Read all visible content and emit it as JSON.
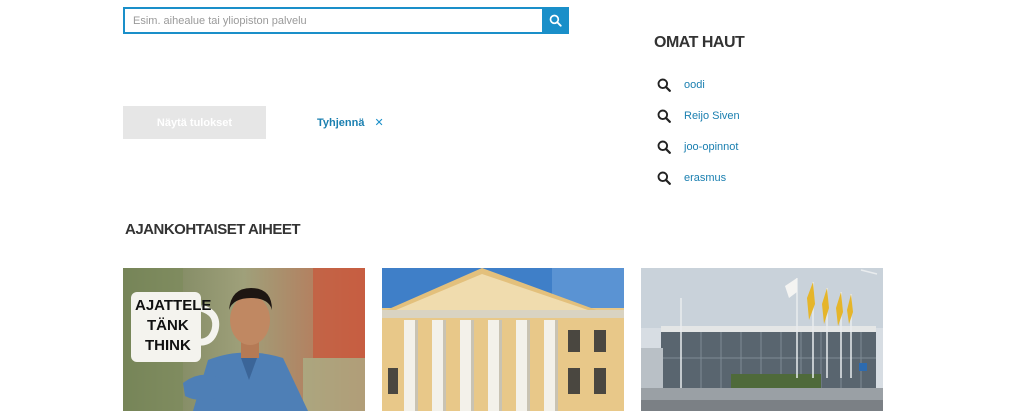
{
  "search": {
    "placeholder": "Esim. aihealue tai yliopiston palvelu",
    "button_icon": "search-icon"
  },
  "actions": {
    "show_results_label": "Näytä tulokset",
    "clear_label": "Tyhjennä",
    "clear_icon": "close-icon"
  },
  "saved_searches": {
    "title": "OMAT HAUT",
    "items": [
      {
        "label": "oodi",
        "icon": "search-icon"
      },
      {
        "label": "Reijo Siven",
        "icon": "search-icon"
      },
      {
        "label": "joo-opinnot",
        "icon": "search-icon"
      },
      {
        "label": "erasmus",
        "icon": "search-icon"
      }
    ]
  },
  "topics": {
    "title": "AJANKOHTAISET AIHEET",
    "cards": [
      {
        "image": "man-with-mug-photo",
        "mug_text": [
          "AJATTELE",
          "TÄNK",
          "THINK"
        ]
      },
      {
        "image": "university-main-building-photo"
      },
      {
        "image": "modern-campus-building-with-flags-photo"
      }
    ]
  },
  "colors": {
    "accent": "#1a8fc9",
    "link": "#1a7fb0",
    "disabled_button": "#e6e6e6",
    "heading": "#333333"
  }
}
